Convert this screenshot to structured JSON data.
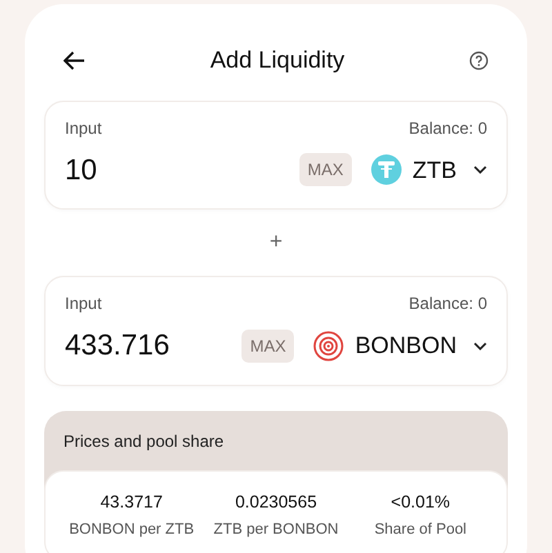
{
  "header": {
    "title": "Add Liquidity"
  },
  "inputs": [
    {
      "label": "Input",
      "balance": "Balance: 0",
      "value": "10",
      "max": "MAX",
      "token": {
        "symbol": "ZTB",
        "kind": "teal"
      }
    },
    {
      "label": "Input",
      "balance": "Balance: 0",
      "value": "433.716",
      "max": "MAX",
      "token": {
        "symbol": "BONBON",
        "kind": "swirl"
      }
    }
  ],
  "separator": "+",
  "prices": {
    "title": "Prices and pool share",
    "items": [
      {
        "value": "43.3717",
        "label": "BONBON per ZTB"
      },
      {
        "value": "0.0230565",
        "label": "ZTB per BONBON"
      },
      {
        "value": "<0.01%",
        "label": "Share of Pool"
      }
    ]
  }
}
